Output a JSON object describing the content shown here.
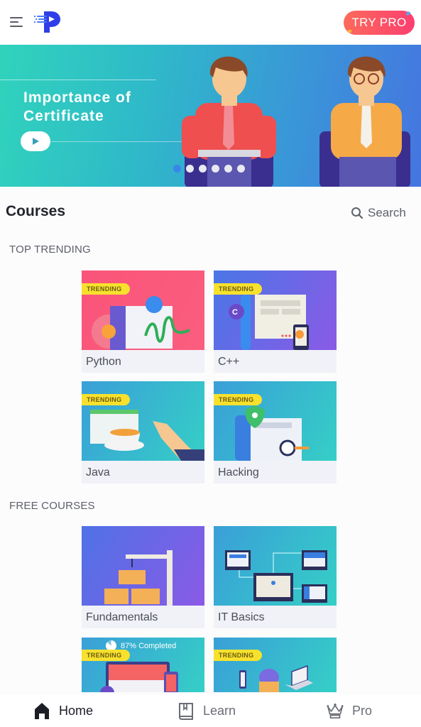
{
  "header": {
    "menu_icon": "hamburger-menu-icon",
    "logo_icon": "brand-p-logo-icon",
    "try_pro_label": "TRY PRO",
    "brand_colors": {
      "primary": "#2f3ee8",
      "try_pro_start": "#fb6a5b",
      "try_pro_end": "#fd3f70"
    }
  },
  "banner": {
    "title_line1": "Importance of",
    "title_line2": "Certificate",
    "play_icon": "play-icon",
    "slide_count": 6,
    "active_slide": 1
  },
  "courses": {
    "title": "Courses",
    "search_label": "Search",
    "search_icon": "search-icon"
  },
  "sections": [
    {
      "label": "TOP TRENDING",
      "items": [
        {
          "name": "Python",
          "badge": "TRENDING",
          "theme": "#f9547a"
        },
        {
          "name": "C++",
          "badge": "TRENDING",
          "theme": "#5a6ae8"
        },
        {
          "name": "Java",
          "badge": "TRENDING",
          "theme": "#33c6c8"
        },
        {
          "name": "Hacking",
          "badge": "TRENDING",
          "theme": "#33c6c8"
        }
      ]
    },
    {
      "label": "FREE COURSES",
      "items": [
        {
          "name": "Fundamentals",
          "badge": "",
          "theme": "#6a60e8"
        },
        {
          "name": "IT Basics",
          "badge": "",
          "theme": "#33c6c8"
        },
        {
          "name": "",
          "badge": "TRENDING",
          "progress_text": "87% Completed",
          "progress": 0.87,
          "theme": "#33c6c8"
        },
        {
          "name": "",
          "badge": "TRENDING",
          "theme": "#33c6c8"
        }
      ]
    }
  ],
  "bottom_nav": [
    {
      "label": "Home",
      "icon": "home-icon",
      "active": true
    },
    {
      "label": "Learn",
      "icon": "book-icon",
      "active": false
    },
    {
      "label": "Pro",
      "icon": "crown-icon",
      "active": false
    }
  ]
}
